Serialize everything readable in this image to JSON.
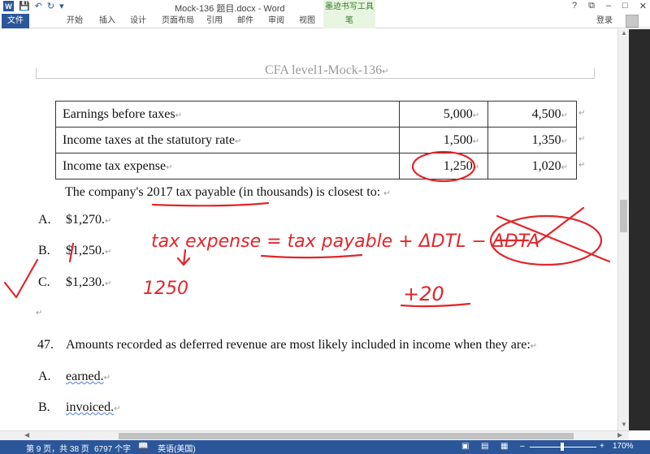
{
  "window": {
    "title": "Mock-136 题目.docx - Word",
    "tool_group": "墨迹书写工具",
    "controls": [
      "?",
      "⧉",
      "–",
      "□",
      "✕"
    ]
  },
  "ribbon": {
    "tabs": [
      "文件",
      "开始",
      "插入",
      "设计",
      "页面布局",
      "引用",
      "邮件",
      "审阅",
      "视图",
      "笔"
    ],
    "login": "登录"
  },
  "document": {
    "header": "CFA level1-Mock-136",
    "table": [
      {
        "label": "Earnings before taxes",
        "v2017": "5,000",
        "v2016": "4,500"
      },
      {
        "label": "Income taxes at the statutory rate",
        "v2017": "1,500",
        "v2016": "1,350"
      },
      {
        "label": "Income tax expense",
        "v2017": "1,250",
        "v2016": "1,020"
      }
    ],
    "q46_stem": "The company's 2017 tax payable (in thousands) is closest to:",
    "q46_options": [
      {
        "letter": "A.",
        "text": "$1,270."
      },
      {
        "letter": "B.",
        "text": "$1,250."
      },
      {
        "letter": "C.",
        "text": "$1,230."
      }
    ],
    "q47_number": "47.",
    "q47_stem": "Amounts recorded as deferred revenue are most likely included in income when they are:",
    "q47_options": [
      {
        "letter": "A.",
        "text": "earned."
      },
      {
        "letter": "B.",
        "text": "invoiced."
      }
    ]
  },
  "ink": {
    "color": "#e0262b",
    "formula": "tax expense = tax payable + ΔDTL − ΔDTA",
    "note_value": "1250",
    "note_delta": "+20"
  },
  "statusbar": {
    "page": "第 9 页，共 38 页",
    "words": "6797 个字",
    "language": "英语(美国)",
    "zoom": "170%"
  }
}
